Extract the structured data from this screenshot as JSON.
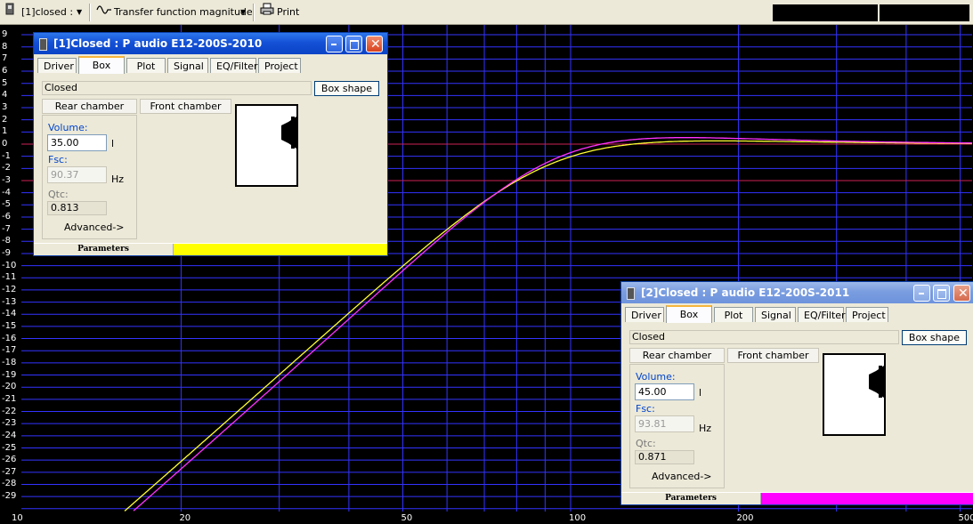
{
  "toolbar": {
    "box_selector": "[1]closed :",
    "plot_selector": "Transfer function magnitude",
    "print_label": "Print"
  },
  "plot": {
    "y_ticks": [
      "9",
      "8",
      "7",
      "6",
      "5",
      "4",
      "3",
      "2",
      "1",
      "0",
      "-1",
      "-2",
      "-3",
      "-4",
      "-5",
      "-6",
      "-7",
      "-8",
      "-9",
      "-10",
      "-11",
      "-12",
      "-13",
      "-14",
      "-15",
      "-16",
      "-17",
      "-18",
      "-19",
      "-20",
      "-21",
      "-22",
      "-23",
      "-24",
      "-25",
      "-26",
      "-27",
      "-28",
      "-29"
    ],
    "x_ticks": [
      "10",
      "20",
      "50",
      "100",
      "200",
      "500"
    ],
    "grid_color": "#3333ff",
    "marker_line_color": "#cc2255",
    "series": [
      {
        "color": "#ffff33",
        "fsc_hz": 90.37,
        "qtc": 0.813
      },
      {
        "color": "#ff33ff",
        "fsc_hz": 93.81,
        "qtc": 0.871
      }
    ]
  },
  "windows": [
    {
      "title": "[1]Closed : P audio E12-200S-2010",
      "tabs": [
        "Driver",
        "Box",
        "Plot",
        "Signal",
        "EQ/Filter",
        "Project"
      ],
      "active_tab": "Box",
      "box_type": "Closed",
      "box_shape_button": "Box shape",
      "rear_chamber": "Rear chamber",
      "front_chamber": "Front chamber",
      "volume_label": "Volume:",
      "volume_value": "35.00",
      "volume_unit": "l",
      "fsc_label": "Fsc:",
      "fsc_value": "90.37",
      "fsc_unit": "Hz",
      "qtc_label": "Qtc:",
      "qtc_value": "0.813",
      "advanced": "Advanced->",
      "status_label": "Parameters",
      "status_color": "#ffff00"
    },
    {
      "title": "[2]Closed : P audio E12-200S-2011",
      "tabs": [
        "Driver",
        "Box",
        "Plot",
        "Signal",
        "EQ/Filter",
        "Project"
      ],
      "active_tab": "Box",
      "box_type": "Closed",
      "box_shape_button": "Box shape",
      "rear_chamber": "Rear chamber",
      "front_chamber": "Front chamber",
      "volume_label": "Volume:",
      "volume_value": "45.00",
      "volume_unit": "l",
      "fsc_label": "Fsc:",
      "fsc_value": "93.81",
      "fsc_unit": "Hz",
      "qtc_label": "Qtc:",
      "qtc_value": "0.871",
      "advanced": "Advanced->",
      "status_label": "Parameters",
      "status_color": "#ff00ff"
    }
  ]
}
